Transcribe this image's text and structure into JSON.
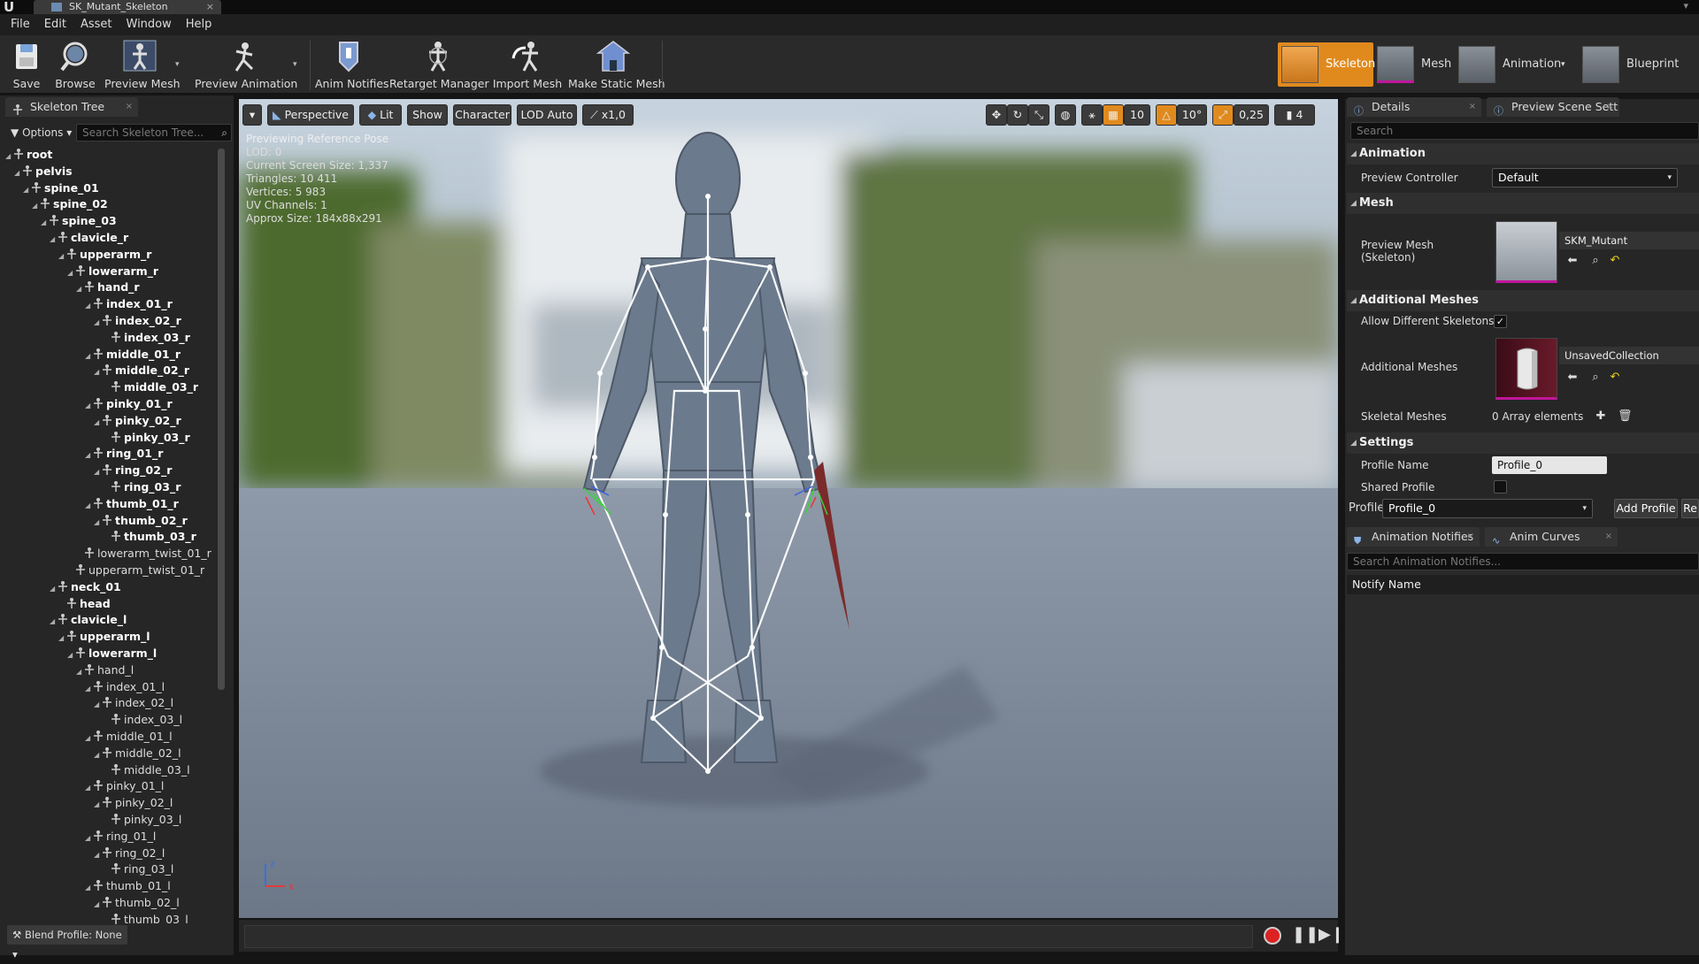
{
  "window": {
    "logo": "U",
    "doc_tab": "SK_Mutant_Skeleton",
    "close": "×",
    "right_icon": "▾"
  },
  "menu": [
    "File",
    "Edit",
    "Asset",
    "Window",
    "Help"
  ],
  "toolbar": {
    "buttons": [
      "Save",
      "Browse",
      "Preview Mesh",
      "Preview Animation",
      "Anim Notifies",
      "Retarget Manager",
      "Import Mesh",
      "Make Static Mesh"
    ],
    "dropdown_caret": "▾"
  },
  "modes": [
    "Skeleton",
    "Mesh",
    "Animation",
    "Blueprint"
  ],
  "skeleton_tree": {
    "tab": "Skeleton Tree",
    "options": "Options",
    "search_placeholder": "Search Skeleton Tree...",
    "bones": [
      {
        "name": "root",
        "depth": 0,
        "bold": true,
        "expand": true
      },
      {
        "name": "pelvis",
        "depth": 1,
        "bold": true,
        "expand": true
      },
      {
        "name": "spine_01",
        "depth": 2,
        "bold": true,
        "expand": true
      },
      {
        "name": "spine_02",
        "depth": 3,
        "bold": true,
        "expand": true
      },
      {
        "name": "spine_03",
        "depth": 4,
        "bold": true,
        "expand": true
      },
      {
        "name": "clavicle_r",
        "depth": 5,
        "bold": true,
        "expand": true
      },
      {
        "name": "upperarm_r",
        "depth": 6,
        "bold": true,
        "expand": true
      },
      {
        "name": "lowerarm_r",
        "depth": 7,
        "bold": true,
        "expand": true
      },
      {
        "name": "hand_r",
        "depth": 8,
        "bold": true,
        "expand": true
      },
      {
        "name": "index_01_r",
        "depth": 9,
        "bold": true,
        "expand": true
      },
      {
        "name": "index_02_r",
        "depth": 10,
        "bold": true,
        "expand": true
      },
      {
        "name": "index_03_r",
        "depth": 11,
        "bold": true,
        "expand": false
      },
      {
        "name": "middle_01_r",
        "depth": 9,
        "bold": true,
        "expand": true
      },
      {
        "name": "middle_02_r",
        "depth": 10,
        "bold": true,
        "expand": true
      },
      {
        "name": "middle_03_r",
        "depth": 11,
        "bold": true,
        "expand": false
      },
      {
        "name": "pinky_01_r",
        "depth": 9,
        "bold": true,
        "expand": true
      },
      {
        "name": "pinky_02_r",
        "depth": 10,
        "bold": true,
        "expand": true
      },
      {
        "name": "pinky_03_r",
        "depth": 11,
        "bold": true,
        "expand": false
      },
      {
        "name": "ring_01_r",
        "depth": 9,
        "bold": true,
        "expand": true
      },
      {
        "name": "ring_02_r",
        "depth": 10,
        "bold": true,
        "expand": true
      },
      {
        "name": "ring_03_r",
        "depth": 11,
        "bold": true,
        "expand": false
      },
      {
        "name": "thumb_01_r",
        "depth": 9,
        "bold": true,
        "expand": true
      },
      {
        "name": "thumb_02_r",
        "depth": 10,
        "bold": true,
        "expand": true
      },
      {
        "name": "thumb_03_r",
        "depth": 11,
        "bold": true,
        "expand": false
      },
      {
        "name": "lowerarm_twist_01_r",
        "depth": 8,
        "bold": false,
        "expand": false
      },
      {
        "name": "upperarm_twist_01_r",
        "depth": 7,
        "bold": false,
        "expand": false
      },
      {
        "name": "neck_01",
        "depth": 5,
        "bold": true,
        "expand": true
      },
      {
        "name": "head",
        "depth": 6,
        "bold": true,
        "expand": false
      },
      {
        "name": "clavicle_l",
        "depth": 5,
        "bold": true,
        "expand": true
      },
      {
        "name": "upperarm_l",
        "depth": 6,
        "bold": true,
        "expand": true
      },
      {
        "name": "lowerarm_l",
        "depth": 7,
        "bold": true,
        "expand": true
      },
      {
        "name": "hand_l",
        "depth": 8,
        "bold": false,
        "expand": true
      },
      {
        "name": "index_01_l",
        "depth": 9,
        "bold": false,
        "expand": true
      },
      {
        "name": "index_02_l",
        "depth": 10,
        "bold": false,
        "expand": true
      },
      {
        "name": "index_03_l",
        "depth": 11,
        "bold": false,
        "expand": false
      },
      {
        "name": "middle_01_l",
        "depth": 9,
        "bold": false,
        "expand": true
      },
      {
        "name": "middle_02_l",
        "depth": 10,
        "bold": false,
        "expand": true
      },
      {
        "name": "middle_03_l",
        "depth": 11,
        "bold": false,
        "expand": false
      },
      {
        "name": "pinky_01_l",
        "depth": 9,
        "bold": false,
        "expand": true
      },
      {
        "name": "pinky_02_l",
        "depth": 10,
        "bold": false,
        "expand": true
      },
      {
        "name": "pinky_03_l",
        "depth": 11,
        "bold": false,
        "expand": false
      },
      {
        "name": "ring_01_l",
        "depth": 9,
        "bold": false,
        "expand": true
      },
      {
        "name": "ring_02_l",
        "depth": 10,
        "bold": false,
        "expand": true
      },
      {
        "name": "ring_03_l",
        "depth": 11,
        "bold": false,
        "expand": false
      },
      {
        "name": "thumb_01_l",
        "depth": 9,
        "bold": false,
        "expand": true
      },
      {
        "name": "thumb_02_l",
        "depth": 10,
        "bold": false,
        "expand": true
      },
      {
        "name": "thumb_03_l",
        "depth": 11,
        "bold": false,
        "expand": false
      }
    ],
    "blend_profile": "Blend Profile: None"
  },
  "viewport": {
    "menu_caret": "▾",
    "buttons": [
      "Perspective",
      "Lit",
      "Show",
      "Character",
      "LOD Auto",
      "x1,0"
    ],
    "info": [
      "Previewing Reference Pose",
      "LOD: 0",
      "Current Screen Size: 1,337",
      "Triangles: 10 411",
      "Vertices: 5 983",
      "UV Channels: 1",
      "Approx Size: 184x88x291"
    ],
    "grid_snap": "10",
    "rot_snap": "10°",
    "scale_snap": "0,25",
    "cam_speed": "4",
    "axis_z": "z",
    "axis_x": "x"
  },
  "details": {
    "tab_details": "Details",
    "tab_scene": "Preview Scene Sett",
    "search_placeholder": "Search",
    "sections": {
      "animation": "Animation",
      "mesh": "Mesh",
      "additional": "Additional Meshes",
      "settings": "Settings"
    },
    "preview_controller_label": "Preview Controller",
    "preview_controller_value": "Default",
    "preview_mesh_label_1": "Preview Mesh",
    "preview_mesh_label_2": "(Skeleton)",
    "preview_mesh_value": "SKM_Mutant",
    "allow_diff_label": "Allow Different Skeletons",
    "allow_diff_checked": true,
    "additional_meshes_label": "Additional Meshes",
    "additional_meshes_value": "UnsavedCollection",
    "skeletal_meshes_label": "Skeletal Meshes",
    "skeletal_meshes_value": "0 Array elements",
    "profile_name_label": "Profile Name",
    "profile_name_value": "Profile_0",
    "shared_profile_label": "Shared Profile",
    "profile_label": "Profile",
    "profile_value": "Profile_0",
    "add_profile": "Add Profile",
    "remove_profile_cut": "Re"
  },
  "notifies": {
    "tab_notifies": "Animation Notifies",
    "tab_curves": "Anim Curves",
    "search_placeholder": "Search Animation Notifies...",
    "column": "Notify Name"
  },
  "colors": {
    "accent": "#e08a1e",
    "panel": "#262626",
    "selection_magenta": "#c0169b"
  }
}
